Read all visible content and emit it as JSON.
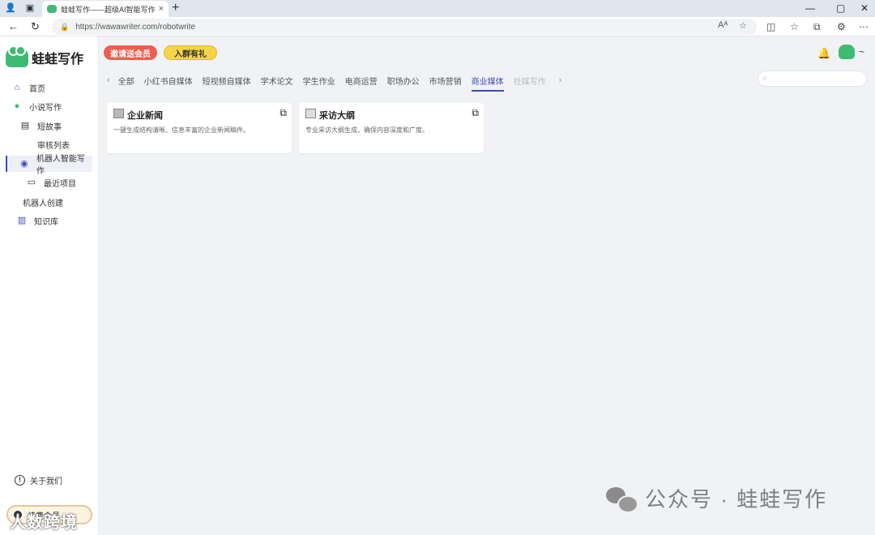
{
  "browser": {
    "tab_title": "蛙蛙写作——超级AI智能写作助手",
    "url_host": "https://wawawriter.com",
    "url_path": "/robotwrite",
    "new_tab": "+",
    "close": "×"
  },
  "sidebar": {
    "brand": "蛙蛙写作",
    "items": [
      {
        "label": "首页"
      },
      {
        "label": "小说写作"
      },
      {
        "label": "短故事"
      },
      {
        "label": "审核列表"
      },
      {
        "label": "机器人智能写作"
      },
      {
        "label": "最近项目"
      },
      {
        "label": "机器人创建"
      },
      {
        "label": "知识库"
      }
    ],
    "about": "关于我们",
    "vip": "续费会员"
  },
  "header": {
    "invite": "邀请送会员",
    "join": "入群有礼",
    "tilde": "~"
  },
  "categories": {
    "items": [
      "全部",
      "小红书自媒体",
      "短视频自媒体",
      "学术论文",
      "学生作业",
      "电商运营",
      "职场办公",
      "市场营销",
      "商业媒体",
      "社媒写作"
    ],
    "active_index": 8
  },
  "cards": [
    {
      "title": "企业新闻",
      "desc": "一键生成结构清晰、信息丰富的企业新闻稿件。"
    },
    {
      "title": "采访大纲",
      "desc": "专业采访大纲生成，确保内容深度和广度。"
    }
  ],
  "watermark": {
    "text": "公众号 · 蛙蛙写作",
    "overlay": "人数跨境"
  },
  "colors": {
    "accent": "#3d4bb5",
    "brand_green": "#3fba73",
    "invite_bg": "#ee5e4e",
    "join_bg": "#f7d34a"
  }
}
